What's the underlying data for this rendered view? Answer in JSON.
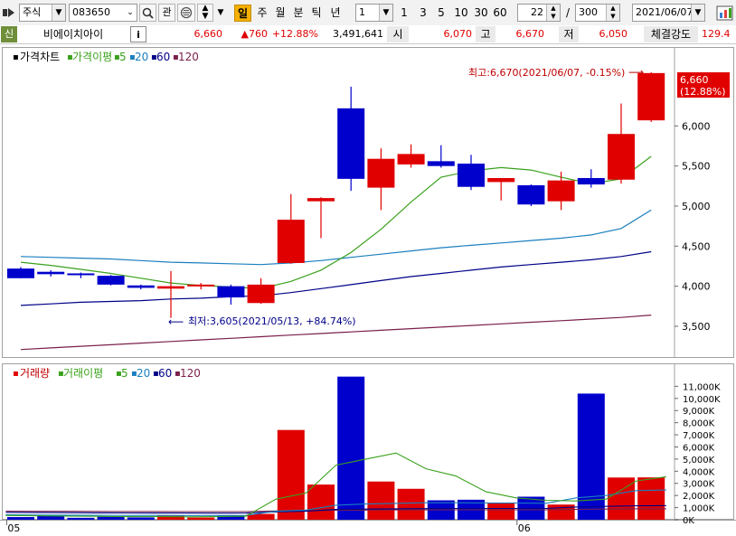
{
  "toolbar": {
    "market": "주식",
    "code": "083650",
    "btn_gwan": "관",
    "period_active": "일",
    "period_others": [
      "주",
      "월",
      "분",
      "틱",
      "년"
    ],
    "interval_value": "1",
    "interval_buttons": [
      "1",
      "3",
      "5",
      "10",
      "30",
      "60"
    ],
    "count_value": "22",
    "slash": "/",
    "count_total": "300",
    "date": "2021/06/07"
  },
  "quote": {
    "badge": "신",
    "name": "비에이치아이",
    "info_btn": "i",
    "price": "6,660",
    "change": "▲760",
    "change_pct": "+12.88%",
    "volume": "3,491,641",
    "open_label": "시",
    "open": "6,070",
    "high_label": "고",
    "high": "6,670",
    "low_label": "저",
    "low": "6,050",
    "strength_label": "체결강도",
    "strength": "129.4"
  },
  "colors": {
    "up": "#e00000",
    "down": "#0000cc",
    "ma5": "#3aa11c",
    "ma20": "#1a7fbf",
    "ma60": "#000088",
    "ma120": "#7a1f4a"
  },
  "chart_data": [
    {
      "type": "candlestick",
      "title": "가격차트",
      "legend": [
        {
          "label": "가격이평",
          "color": "#3aa11c"
        },
        {
          "label": "5",
          "color": "#3aa11c"
        },
        {
          "label": "20",
          "color": "#1a7fbf"
        },
        {
          "label": "60",
          "color": "#000088"
        },
        {
          "label": "120",
          "color": "#7a1f4a"
        }
      ],
      "ylim": [
        3150,
        6850
      ],
      "yticks": [
        3500,
        4000,
        4500,
        5000,
        5500,
        6000
      ],
      "ytick_labels": [
        "3,500",
        "4,000",
        "4,500",
        "5,000",
        "5,500",
        "6,000"
      ],
      "xtick_labels": [
        {
          "index": 0,
          "label": "05"
        },
        {
          "index": 17,
          "label": "06"
        }
      ],
      "candles": [
        {
          "o": 4220,
          "h": 4240,
          "l": 4100,
          "c": 4100
        },
        {
          "o": 4180,
          "h": 4200,
          "l": 4120,
          "c": 4150
        },
        {
          "o": 4160,
          "h": 4170,
          "l": 4100,
          "c": 4140
        },
        {
          "o": 4130,
          "h": 4140,
          "l": 4010,
          "c": 4020
        },
        {
          "o": 4010,
          "h": 4020,
          "l": 3960,
          "c": 3980
        },
        {
          "o": 3970,
          "h": 4190,
          "l": 3605,
          "c": 4000
        },
        {
          "o": 4000,
          "h": 4040,
          "l": 3960,
          "c": 4020
        },
        {
          "o": 4000,
          "h": 4020,
          "l": 3770,
          "c": 3860
        },
        {
          "o": 3790,
          "h": 4100,
          "l": 3780,
          "c": 4020
        },
        {
          "o": 4290,
          "h": 5150,
          "l": 4280,
          "c": 4830
        },
        {
          "o": 5060,
          "h": 5110,
          "l": 4600,
          "c": 5100
        },
        {
          "o": 6220,
          "h": 6490,
          "l": 5190,
          "c": 5340
        },
        {
          "o": 5230,
          "h": 5720,
          "l": 4950,
          "c": 5590
        },
        {
          "o": 5520,
          "h": 5770,
          "l": 5480,
          "c": 5650
        },
        {
          "o": 5560,
          "h": 5760,
          "l": 5480,
          "c": 5500
        },
        {
          "o": 5530,
          "h": 5640,
          "l": 5200,
          "c": 5240
        },
        {
          "o": 5300,
          "h": 5330,
          "l": 5070,
          "c": 5350
        },
        {
          "o": 5260,
          "h": 5270,
          "l": 5000,
          "c": 5020
        },
        {
          "o": 5060,
          "h": 5430,
          "l": 4950,
          "c": 5320
        },
        {
          "o": 5350,
          "h": 5460,
          "l": 5230,
          "c": 5270
        },
        {
          "o": 5330,
          "h": 6280,
          "l": 5280,
          "c": 5900
        },
        {
          "o": 6070,
          "h": 6670,
          "l": 6050,
          "c": 6660
        }
      ],
      "ma5": [
        4300,
        4260,
        4210,
        4160,
        4100,
        4040,
        4010,
        3990,
        3970,
        4060,
        4200,
        4420,
        4710,
        5050,
        5360,
        5440,
        5480,
        5450,
        5360,
        5280,
        5340,
        5620
      ],
      "ma20": [
        4370,
        4360,
        4350,
        4340,
        4320,
        4300,
        4290,
        4280,
        4270,
        4290,
        4320,
        4360,
        4400,
        4440,
        4480,
        4510,
        4540,
        4570,
        4600,
        4640,
        4720,
        4950
      ],
      "ma60": [
        3760,
        3780,
        3800,
        3810,
        3820,
        3840,
        3850,
        3870,
        3880,
        3920,
        3970,
        4020,
        4070,
        4120,
        4160,
        4200,
        4240,
        4270,
        4300,
        4330,
        4370,
        4430
      ],
      "ma120": [
        3210,
        3230,
        3250,
        3270,
        3290,
        3310,
        3330,
        3350,
        3370,
        3390,
        3410,
        3430,
        3450,
        3470,
        3490,
        3510,
        3530,
        3550,
        3570,
        3590,
        3610,
        3640
      ],
      "annotations": {
        "max_label": "최고:6,670(2021/06/07, -0.15%)",
        "max_arrow": "⟶",
        "min_label": "최저:3,605(2021/05/13, +84.74%)",
        "min_arrow": "⟵",
        "last_price": "6,660",
        "last_pct": "(12.88%)"
      }
    },
    {
      "type": "bar",
      "title": "거래량",
      "legend": [
        {
          "label": "거래이평",
          "color": "#3aa11c"
        },
        {
          "label": "5",
          "color": "#3aa11c"
        },
        {
          "label": "20",
          "color": "#1a7fbf"
        },
        {
          "label": "60",
          "color": "#000088"
        },
        {
          "label": "120",
          "color": "#7a1f4a"
        }
      ],
      "ylim": [
        0,
        11700
      ],
      "yticks": [
        0,
        1000,
        2000,
        3000,
        4000,
        5000,
        6000,
        7000,
        8000,
        9000,
        10000,
        11000
      ],
      "ytick_labels": [
        "0K",
        "1,000K",
        "2,000K",
        "3,000K",
        "4,000K",
        "5,000K",
        "6,000K",
        "7,000K",
        "8,000K",
        "9,000K",
        "10,000K",
        "11,000K"
      ],
      "volumes": [
        220,
        300,
        160,
        250,
        190,
        360,
        180,
        340,
        480,
        7400,
        2900,
        11800,
        3150,
        2550,
        1600,
        1650,
        1420,
        1900,
        1250,
        10400,
        3480,
        3491
      ],
      "vol_ma5": [
        350,
        330,
        300,
        280,
        250,
        260,
        240,
        250,
        290,
        1700,
        2200,
        4500,
        5000,
        5500,
        4200,
        3600,
        2300,
        1800,
        1600,
        1550,
        1700,
        3200,
        3550
      ],
      "vol_ma20": [
        400,
        390,
        380,
        370,
        360,
        360,
        350,
        350,
        360,
        700,
        800,
        1200,
        1300,
        1350,
        1400,
        1400,
        1380,
        1380,
        1360,
        1800,
        2000,
        2400,
        2450
      ],
      "vol_ma60": [
        600,
        590,
        580,
        570,
        560,
        555,
        550,
        545,
        550,
        650,
        700,
        850,
        880,
        900,
        920,
        930,
        930,
        935,
        935,
        1050,
        1100,
        1150,
        1160
      ],
      "vol_ma120": [
        700,
        695,
        690,
        685,
        680,
        675,
        670,
        668,
        670,
        720,
        740,
        790,
        800,
        810,
        815,
        820,
        820,
        822,
        822,
        860,
        880,
        900,
        905
      ]
    }
  ]
}
